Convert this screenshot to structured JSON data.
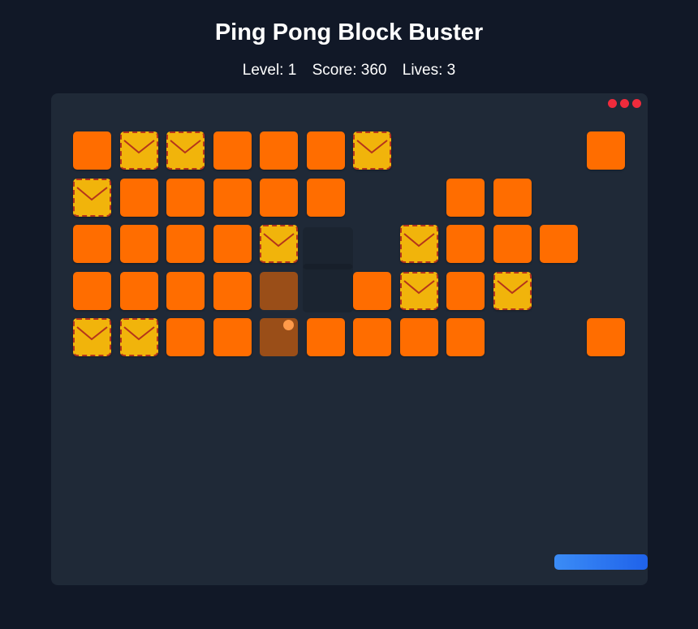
{
  "header": {
    "title": "Ping Pong Block Buster"
  },
  "stats": {
    "level": "Level: 1",
    "score": "Score: 360",
    "lives": "Lives: 3"
  },
  "game": {
    "lives_remaining": 3,
    "grid": [
      [
        "block",
        "special",
        "special",
        "block",
        "block",
        "block",
        "special",
        null,
        null,
        null,
        null,
        "block"
      ],
      [
        "special",
        "block",
        "block",
        "block",
        "block",
        "block",
        null,
        null,
        "block",
        "block",
        null,
        null
      ],
      [
        "block",
        "block",
        "block",
        "block",
        "special",
        null,
        null,
        "special",
        "block",
        "block",
        "block",
        null
      ],
      [
        "block",
        "block",
        "block",
        "block",
        "faded",
        null,
        "block",
        "special",
        "block",
        "special",
        null,
        null
      ],
      [
        "special",
        "special",
        "block",
        "block",
        "faded",
        "block",
        "block",
        "block",
        "block",
        null,
        null,
        "block"
      ]
    ]
  },
  "colors": {
    "background": "#111827",
    "board": "#1f2937",
    "block": "#ff6d00",
    "special_block": "#f1b40b",
    "special_border": "#b5341b",
    "life_dot": "#ef2b3c",
    "ball": "#ff9a4a",
    "paddle": "#2563eb"
  }
}
